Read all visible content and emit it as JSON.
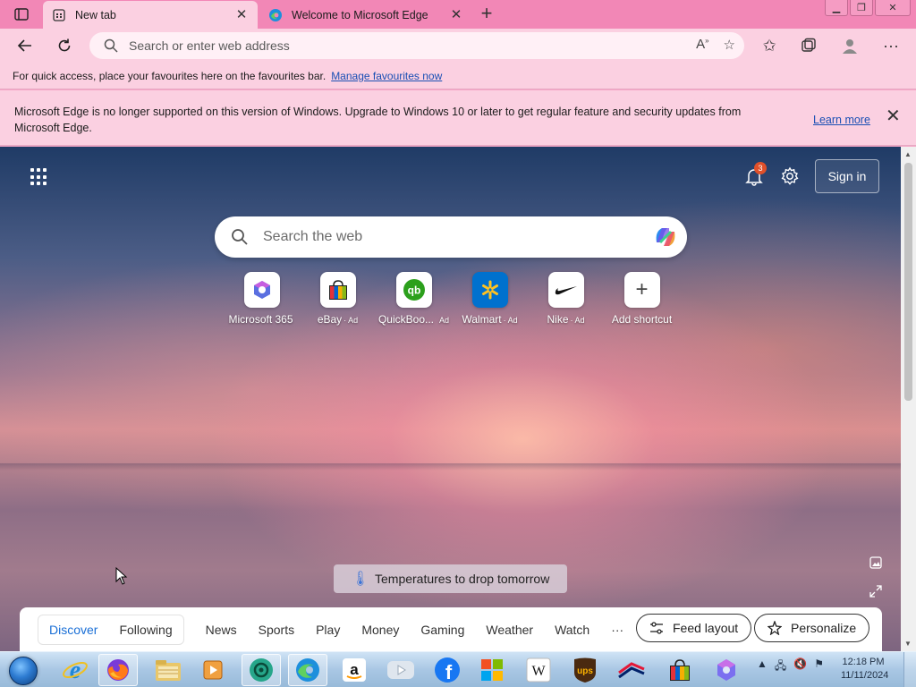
{
  "browser": {
    "tabs": [
      {
        "title": "New tab",
        "active": true
      },
      {
        "title": "Welcome to Microsoft Edge",
        "active": false
      }
    ],
    "address_placeholder": "Search or enter web address",
    "favourites_bar": {
      "text": "For quick access, place your favourites here on the favourites bar.",
      "link": "Manage favourites now"
    },
    "infobar": {
      "message": "Microsoft Edge is no longer supported on this version of Windows. Upgrade to Windows 10 or later to get regular feature and security updates from Microsoft Edge.",
      "link": "Learn more"
    }
  },
  "ntp": {
    "notification_count": "3",
    "sign_in": "Sign in",
    "search_placeholder": "Search the web",
    "shortcuts": [
      {
        "label": "Microsoft 365",
        "ad": "",
        "icon": "microsoft-365-icon"
      },
      {
        "label": "eBay",
        "ad": "· Ad",
        "icon": "ebay-icon"
      },
      {
        "label": "QuickBoo...",
        "ad": "Ad",
        "icon": "quickbooks-icon"
      },
      {
        "label": "Walmart",
        "ad": "· Ad",
        "icon": "walmart-icon"
      },
      {
        "label": "Nike",
        "ad": "· Ad",
        "icon": "nike-icon"
      },
      {
        "label": "Add shortcut",
        "ad": "",
        "icon": "plus-icon"
      }
    ],
    "news_pill": "Temperatures to drop tomorrow",
    "feed": {
      "tabs": [
        "Discover",
        "Following"
      ],
      "items": [
        "News",
        "Sports",
        "Play",
        "Money",
        "Gaming",
        "Weather",
        "Watch",
        "···"
      ],
      "feed_layout": "Feed layout",
      "personalize": "Personalize"
    }
  },
  "taskbar": {
    "apps": [
      "internet-explorer-icon",
      "firefox-icon",
      "file-explorer-icon",
      "media-player-icon",
      "chatgpt-icon",
      "edge-icon",
      "amazon-icon",
      "youtube-icon",
      "facebook-icon",
      "microsoft-store-icon",
      "wikipedia-icon",
      "ups-icon",
      "bank-of-america-icon",
      "shopping-bag-icon",
      "copilot-icon"
    ],
    "time": "12:18 PM",
    "date": "11/11/2024"
  },
  "colors": {
    "tabstrip": "#f287b6",
    "toolbar": "#fbd0e1",
    "accent_link": "#1a4fb4",
    "feed_selected": "#1a6fd6"
  }
}
